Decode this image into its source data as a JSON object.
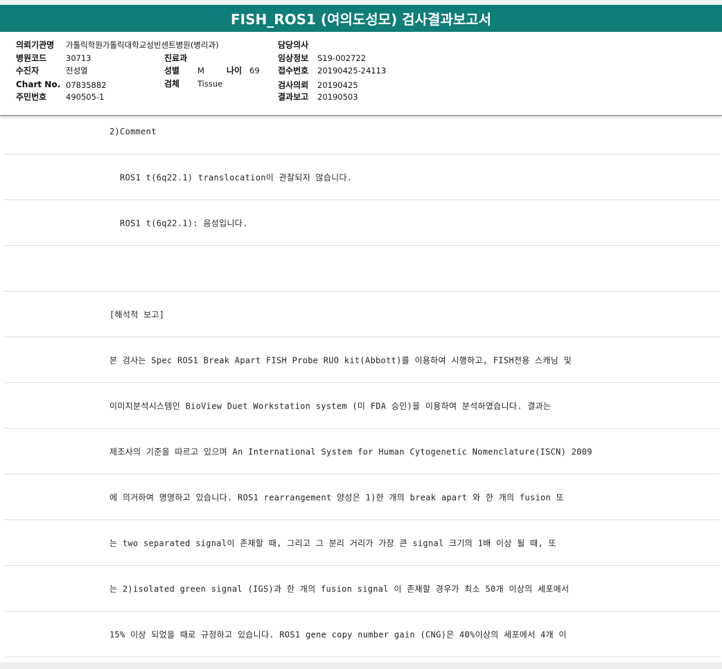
{
  "title": "FISH_ROS1 (여의도성모) 검사결과보고서",
  "header": {
    "institution_label": "의뢰기관명",
    "institution_value": "가톨릭학원가톨릭대학교성빈센트병원(병리과)",
    "attending_label": "담당의사",
    "attending_value": "",
    "hospital_code_label": "병원코드",
    "hospital_code_value": "30713",
    "department_label": "진료과",
    "department_value": "",
    "clinical_info_label": "임상정보",
    "clinical_info_value": "S19-002722",
    "patient_label": "수진자",
    "patient_value": "전성열",
    "sex_label": "성별",
    "sex_value": "M",
    "age_label": "나이",
    "age_value": "69",
    "receipt_label": "접수번호",
    "receipt_value": "20190425-24113",
    "chart_label": "Chart No.",
    "chart_value": "07835882",
    "specimen_label": "검체",
    "specimen_value": "Tissue",
    "request_label": "검사의뢰",
    "request_value": "20190425",
    "resident_label": "주민번호",
    "resident_value": "490505-1",
    "report_label": "결과보고",
    "report_value": "20190503"
  },
  "rows": [
    "2)Comment",
    "  ROS1 t(6q22.1) translocation이 관찰되지 않습니다.",
    "  ROS1 t(6q22.1): 음성입니다.",
    "",
    "[해석적 보고]",
    "본 검사는 Spec ROS1 Break Apart FISH Probe RUO kit(Abbott)를 이용하여 시행하고, FISH전용 스캐닝 및",
    "이미지분석시스템인 BioView Duet Workstation system (미 FDA 승인)을 이용하여 분석하였습니다. 결과는",
    "제조사의 기준을 따르고 있으며 An International System for Human Cytogenetic Nomenclature(ISCN) 2009",
    "에 의거하여 명명하고 있습니다. ROS1 rearrangement 양성은 1)한 개의 break apart 와 한 개의 fusion 또",
    "는 two separated signal이 존재할 때, 그리고 그 분리 거리가 가장 큰 signal 크기의 1배 이상 될 때, 또",
    "는 2)isolated green signal (IGS)과 한 개의 fusion signal 이 존재할 경우가 최소 50개 이상의 세포에서",
    "15% 이상 되었을 때로 규정하고 있습니다. ROS1 gene copy number gain (CNG)은 40%이상의 세포에서 4개 이"
  ]
}
